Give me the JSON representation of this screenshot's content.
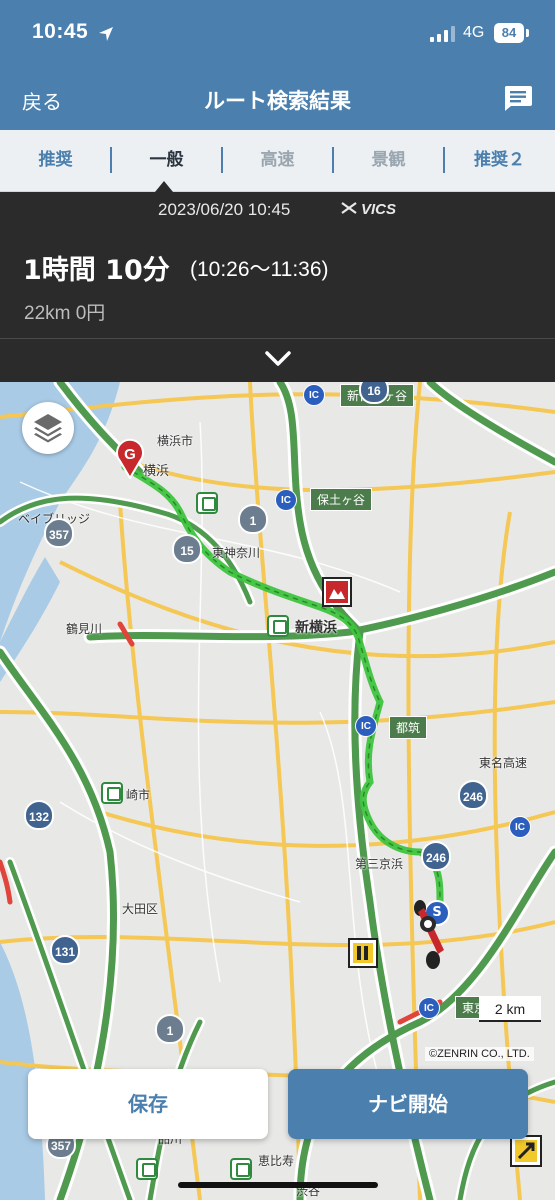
{
  "status_bar": {
    "time": "10:45",
    "network": "4G",
    "battery": "84"
  },
  "nav": {
    "back_label": "戻る",
    "title": "ルート検索結果",
    "message_icon": "chat-bubble-icon"
  },
  "tabs": [
    {
      "label": "推奨",
      "state": "inactive-blue"
    },
    {
      "label": "一般",
      "state": "active"
    },
    {
      "label": "高速",
      "state": "inactive"
    },
    {
      "label": "景観",
      "state": "inactive"
    },
    {
      "label": "推奨２",
      "state": "inactive-blue"
    }
  ],
  "route": {
    "datetime": "2023/06/20 10:45",
    "vics_label": "VICS",
    "duration": "1時間 10分",
    "time_range": "(10:26〜11:36)",
    "distance_toll": "22km  0円"
  },
  "map": {
    "labels": {
      "yokohama_city": "横浜市",
      "yokohama": "横浜",
      "bay_bridge": "ベイブリッジ",
      "tsurumi": "鶴見川",
      "higashikanagawa": "東神奈川",
      "shinyokohama": "新横浜",
      "kawasaki": "崎市",
      "ota": "大田区",
      "daisan_keihin": "第三京浜",
      "tomei": "東名高速",
      "shinagawa": "品川",
      "ebisu": "恵比寿",
      "shibuya": "渋谷"
    },
    "place_boxes": {
      "hodogaya": "保土ヶ谷",
      "tsuzuki": "都筑",
      "tokyo": "東京",
      "hodogaya_top": "新保土ヶ谷"
    },
    "ic_label": "IC",
    "shields": {
      "r16": "16",
      "r1a": "1",
      "r15": "15",
      "r357a": "357",
      "r246a": "246",
      "r246b": "246",
      "r132": "132",
      "r131": "131",
      "r1b": "1",
      "r357b": "357"
    },
    "goal_label": "G",
    "start_label": "S",
    "scale": "2 km",
    "copyright": "©ZENRIN CO., LTD."
  },
  "actions": {
    "save_label": "保存",
    "navi_label": "ナビ開始"
  },
  "colors": {
    "brand_blue": "#4a7fae",
    "route_green": "#3ec43e",
    "traffic_green": "#4f9a4f",
    "dark_panel": "#2b2b2b"
  }
}
